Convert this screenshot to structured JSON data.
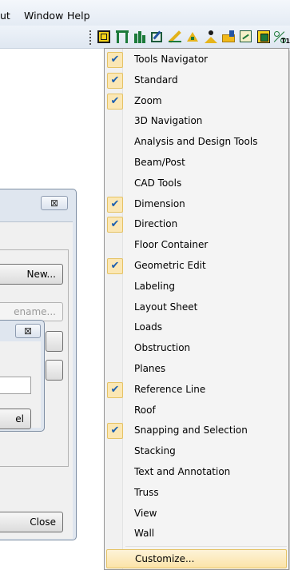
{
  "menubar": {
    "items": [
      "ut",
      "Window",
      "Help"
    ]
  },
  "toolbar": {
    "icons": [
      "view-icon",
      "frame-icon",
      "column-icon",
      "edit-icon",
      "pencil-icon",
      "triangle-icon",
      "person-icon",
      "folder-icon",
      "chart-icon",
      "label-icon",
      "percent-icon"
    ],
    "t1_label": "T1"
  },
  "dialog_main": {
    "close_glyph": "⊠",
    "new_button": "New...",
    "rename_button": "ename...",
    "close_button": "Close"
  },
  "dialog_small": {
    "close_glyph": "⊠",
    "cancel_button": "el"
  },
  "menu": {
    "items": [
      {
        "label": "Tools Navigator",
        "checked": true
      },
      {
        "label": "Standard",
        "checked": true
      },
      {
        "label": "Zoom",
        "checked": true
      },
      {
        "label": "3D Navigation",
        "checked": false
      },
      {
        "label": "Analysis and Design Tools",
        "checked": false
      },
      {
        "label": "Beam/Post",
        "checked": false
      },
      {
        "label": "CAD Tools",
        "checked": false
      },
      {
        "label": "Dimension",
        "checked": true
      },
      {
        "label": "Direction",
        "checked": true
      },
      {
        "label": "Floor Container",
        "checked": false
      },
      {
        "label": "Geometric Edit",
        "checked": true
      },
      {
        "label": "Labeling",
        "checked": false
      },
      {
        "label": "Layout Sheet",
        "checked": false
      },
      {
        "label": "Loads",
        "checked": false
      },
      {
        "label": "Obstruction",
        "checked": false
      },
      {
        "label": "Planes",
        "checked": false
      },
      {
        "label": "Reference Line",
        "checked": true
      },
      {
        "label": "Roof",
        "checked": false
      },
      {
        "label": "Snapping and Selection",
        "checked": true
      },
      {
        "label": "Stacking",
        "checked": false
      },
      {
        "label": "Text and Annotation",
        "checked": false
      },
      {
        "label": "Truss",
        "checked": false
      },
      {
        "label": "View",
        "checked": false
      },
      {
        "label": "Wall",
        "checked": false
      }
    ],
    "customize": "Customize...",
    "check_glyph": "✔"
  }
}
